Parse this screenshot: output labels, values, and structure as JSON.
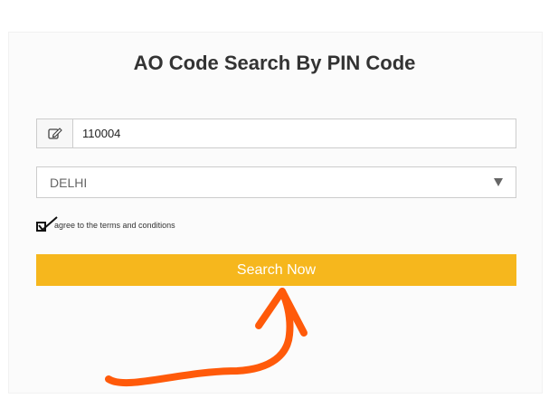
{
  "form": {
    "title": "AO Code Search By PIN Code",
    "pin": {
      "value": "110004",
      "icon": "edit-icon"
    },
    "state": {
      "selected": "DELHI",
      "icon": "dropdown-arrow-icon"
    },
    "terms": {
      "checked": true,
      "label": "agree to the terms and conditions"
    },
    "search_label": "Search Now"
  },
  "colors": {
    "button": "#f6b71d",
    "annotation_arrow": "#ff5a0a"
  }
}
